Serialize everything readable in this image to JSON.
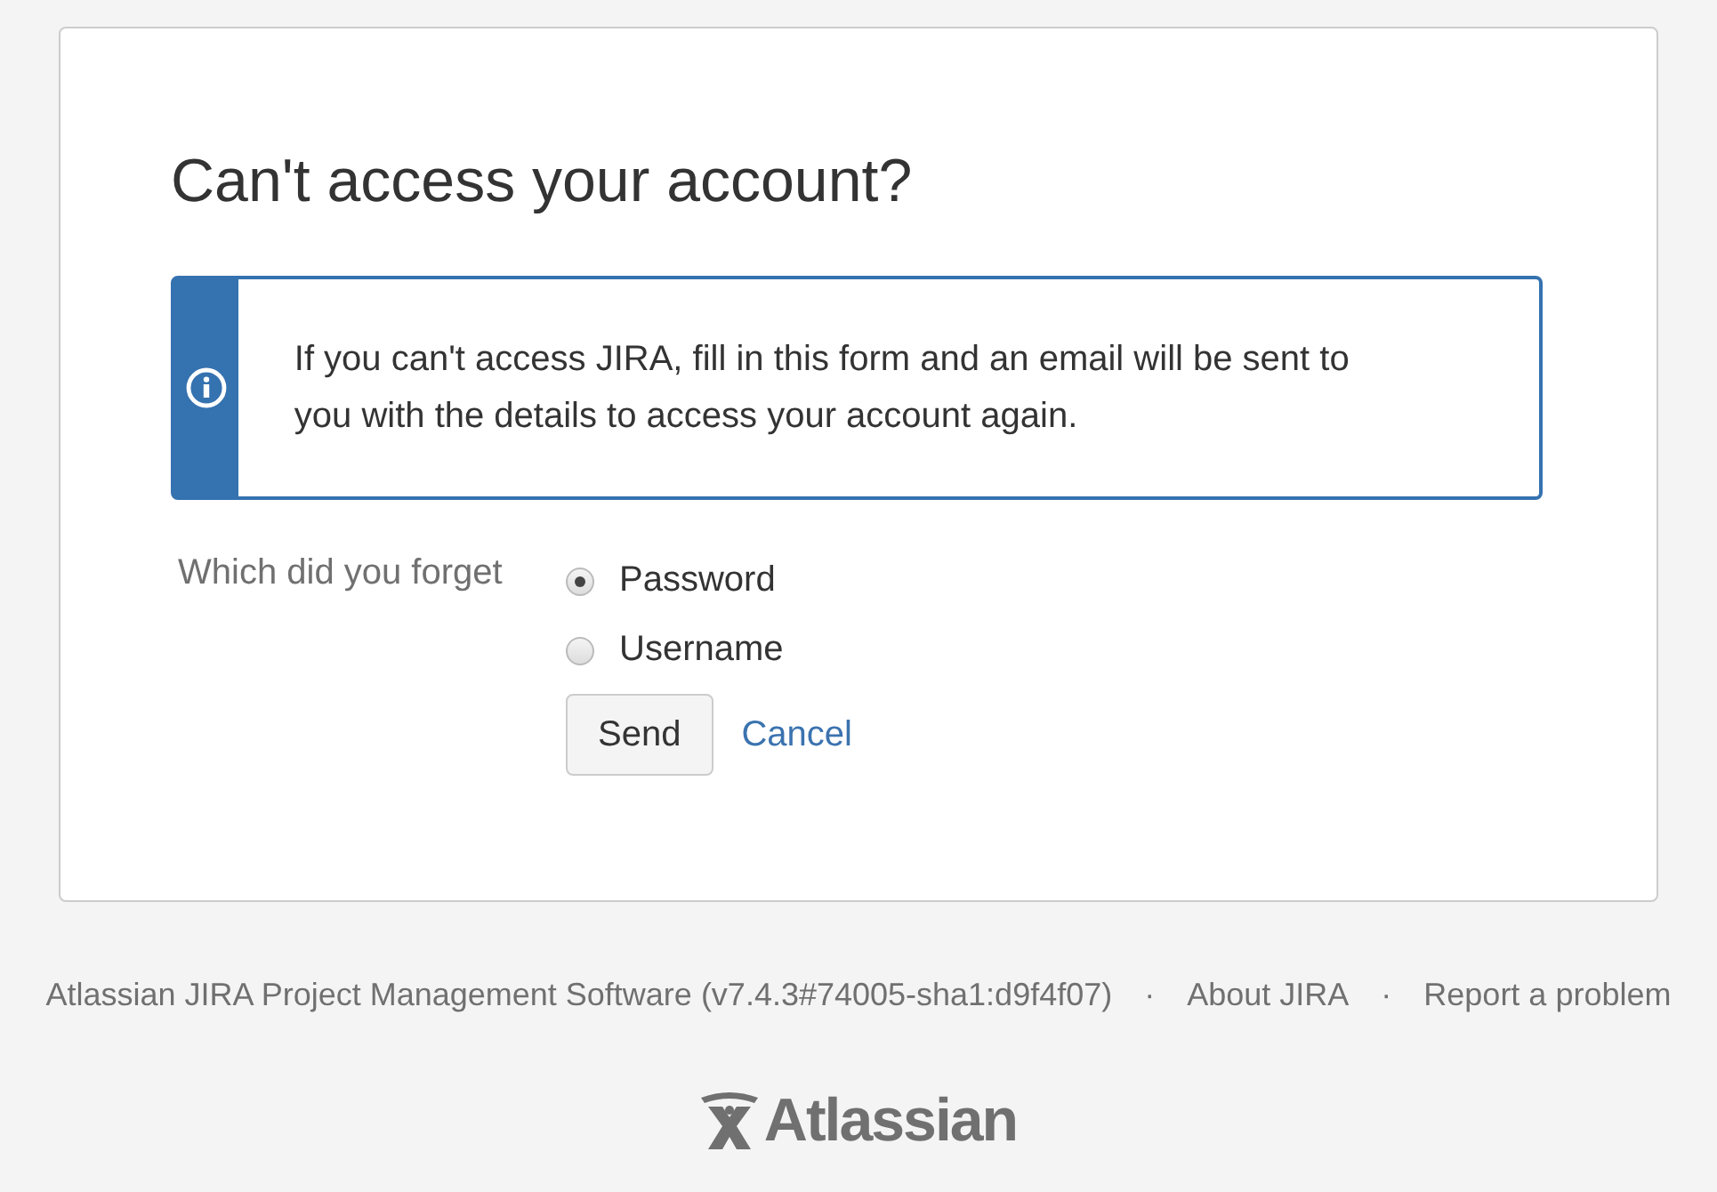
{
  "title": "Can't access your account?",
  "info": {
    "text": "If you can't access JIRA, fill in this form and an email will be sent to you with the details to access your account again."
  },
  "form": {
    "label": "Which did you forget",
    "options": [
      {
        "label": "Password",
        "selected": true
      },
      {
        "label": "Username",
        "selected": false
      }
    ],
    "buttons": [
      {
        "kind": "button",
        "label": "Send"
      },
      {
        "kind": "link",
        "label": "Cancel"
      }
    ]
  },
  "footer": {
    "items": [
      {
        "kind": "text",
        "label": "Atlassian JIRA Project Management Software (v7.4.3#74005-sha1:d9f4f07)"
      },
      {
        "kind": "separator",
        "label": "·"
      },
      {
        "kind": "link",
        "label": "About JIRA"
      },
      {
        "kind": "separator",
        "label": "·"
      },
      {
        "kind": "link",
        "label": "Report a problem"
      }
    ],
    "logo": "Atlassian"
  }
}
